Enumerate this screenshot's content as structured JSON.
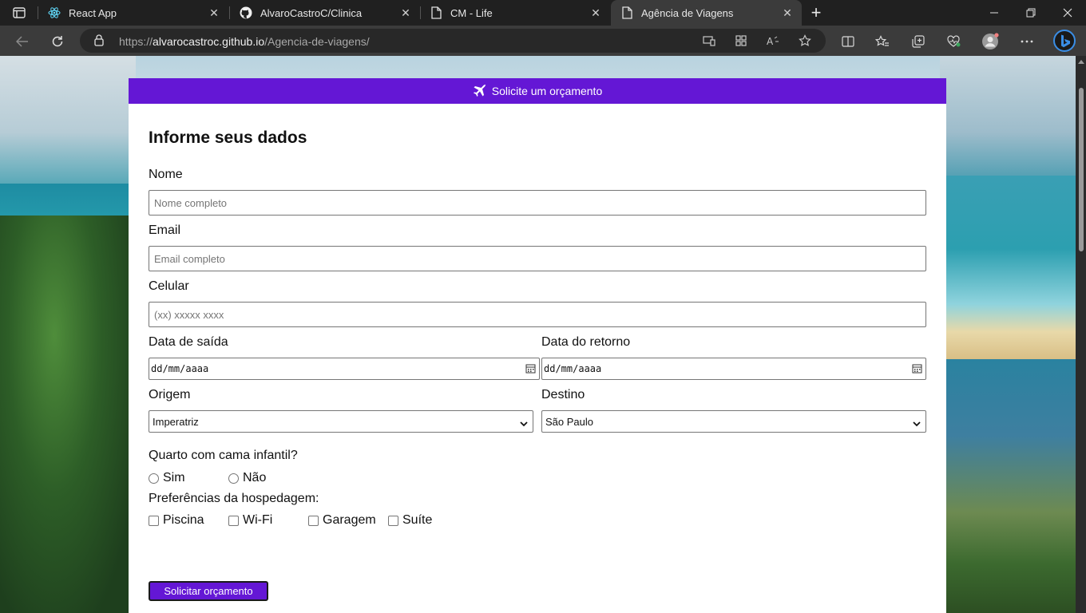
{
  "browser": {
    "tabs": [
      {
        "title": "React App",
        "icon": "react-icon"
      },
      {
        "title": "AlvaroCastroC/Clinica",
        "icon": "github-icon"
      },
      {
        "title": "CM - Life",
        "icon": "page-icon"
      },
      {
        "title": "Agência de Viagens",
        "icon": "page-icon",
        "active": true
      }
    ],
    "address": {
      "scheme": "https://",
      "host": "alvarocastroc.github.io",
      "path": "/Agencia-de-viagens/"
    }
  },
  "page": {
    "header_text": "Solicite um orçamento",
    "heading": "Informe seus dados",
    "fields": {
      "nome": {
        "label": "Nome",
        "placeholder": "Nome completo"
      },
      "email": {
        "label": "Email",
        "placeholder": "Email completo"
      },
      "celular": {
        "label": "Celular",
        "placeholder": "(xx) xxxxx xxxx"
      },
      "data_saida": {
        "label": "Data de saída",
        "value": "dd/mm/aaaa"
      },
      "data_retorno": {
        "label": "Data do retorno",
        "value": "dd/mm/aaaa"
      },
      "origem": {
        "label": "Origem",
        "value": "Imperatriz"
      },
      "destino": {
        "label": "Destino",
        "value": "São Paulo"
      }
    },
    "quarto": {
      "question": "Quarto com cama infantil?",
      "options": [
        "Sim",
        "Não"
      ]
    },
    "preferencias": {
      "label": "Preferências da hospedagem:",
      "options": [
        "Piscina",
        "Wi-Fi",
        "Garagem",
        "Suíte"
      ]
    },
    "submit_label": "Solicitar orçamento"
  },
  "colors": {
    "accent": "#6417d5"
  }
}
